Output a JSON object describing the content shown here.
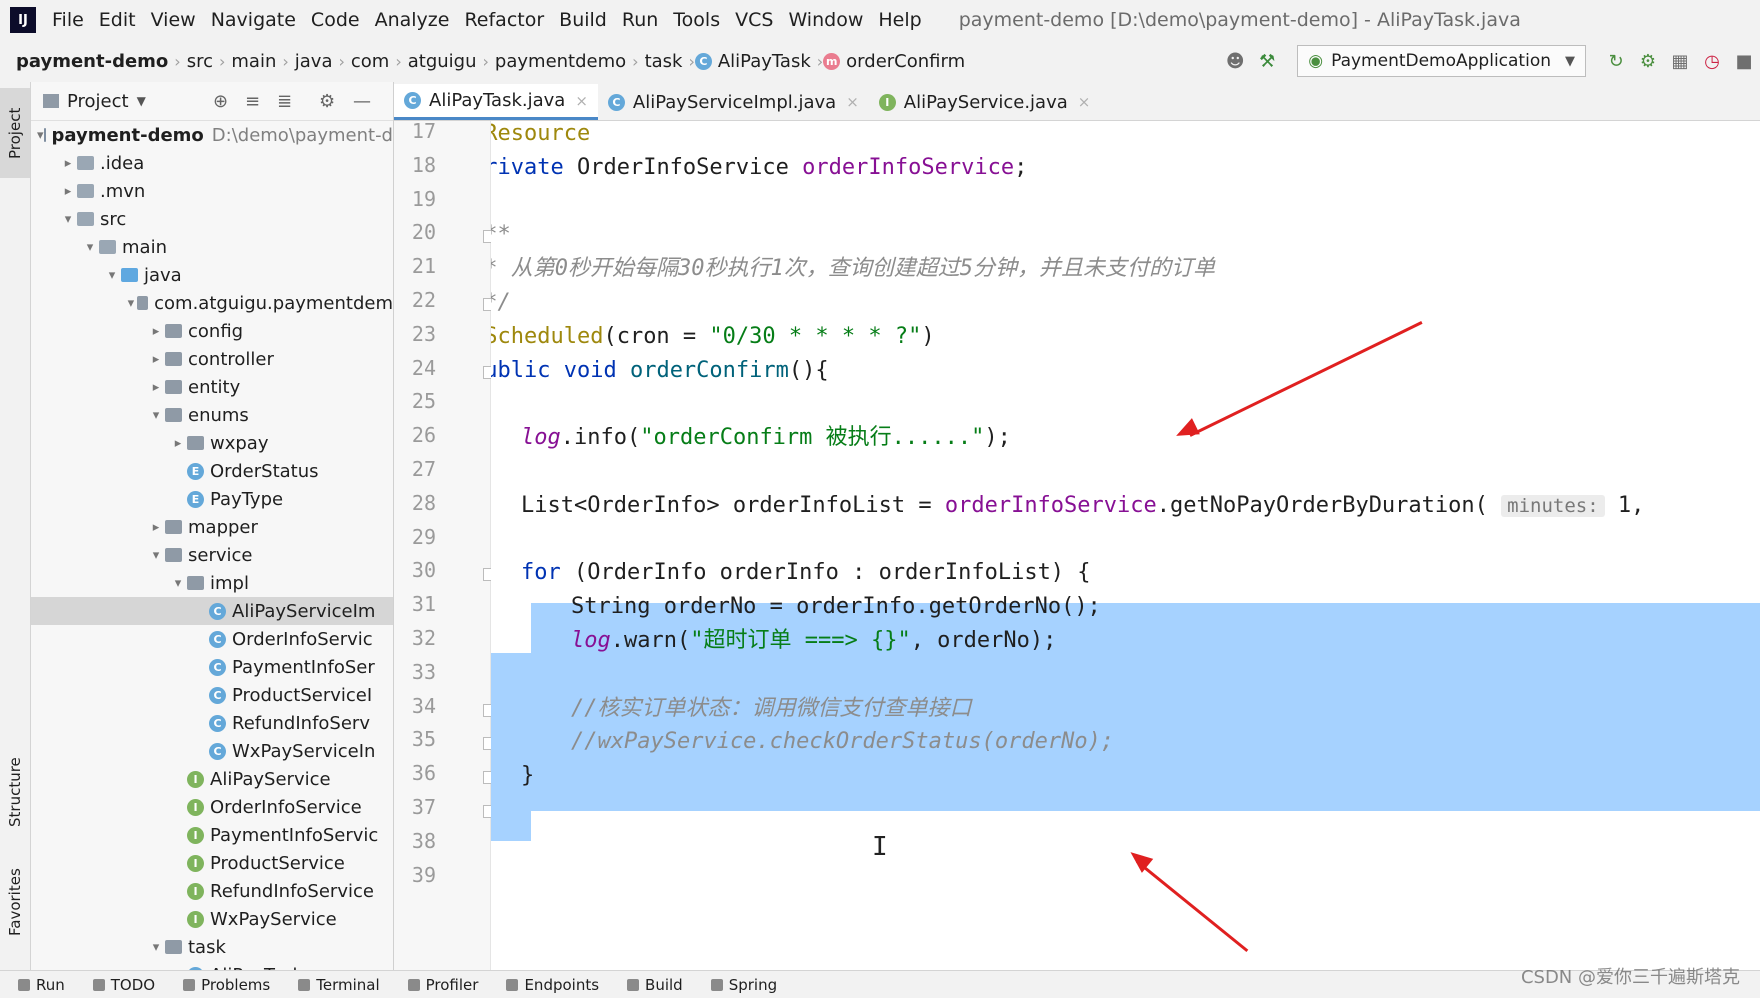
{
  "menubar": {
    "logo": "IJ",
    "items": [
      "File",
      "Edit",
      "View",
      "Navigate",
      "Code",
      "Analyze",
      "Refactor",
      "Build",
      "Run",
      "Tools",
      "VCS",
      "Window",
      "Help"
    ],
    "window_title": "payment-demo [D:\\demo\\payment-demo] - AliPayTask.java"
  },
  "breadcrumb": {
    "items": [
      "payment-demo",
      "src",
      "main",
      "java",
      "com",
      "atguigu",
      "paymentdemo",
      "task",
      "AliPayTask",
      "orderConfirm"
    ]
  },
  "run_config": {
    "label": "PaymentDemoApplication"
  },
  "side_tabs": {
    "project": "Project",
    "structure": "Structure",
    "favorites": "Favorites"
  },
  "project_panel": {
    "title": "Project",
    "tree": [
      {
        "label": "payment-demo",
        "path": "D:\\demo\\payment-d",
        "depth": 0,
        "arrow": "▾",
        "icon": "module",
        "bold": true
      },
      {
        "label": ".idea",
        "depth": 1,
        "arrow": "▸",
        "icon": "folder"
      },
      {
        "label": ".mvn",
        "depth": 1,
        "arrow": "▸",
        "icon": "folder"
      },
      {
        "label": "src",
        "depth": 1,
        "arrow": "▾",
        "icon": "folder"
      },
      {
        "label": "main",
        "depth": 2,
        "arrow": "▾",
        "icon": "folder"
      },
      {
        "label": "java",
        "depth": 3,
        "arrow": "▾",
        "icon": "blue"
      },
      {
        "label": "com.atguigu.paymentdem",
        "depth": 4,
        "arrow": "▾",
        "icon": "pkg"
      },
      {
        "label": "config",
        "depth": 5,
        "arrow": "▸",
        "icon": "pkg"
      },
      {
        "label": "controller",
        "depth": 5,
        "arrow": "▸",
        "icon": "pkg"
      },
      {
        "label": "entity",
        "depth": 5,
        "arrow": "▸",
        "icon": "pkg"
      },
      {
        "label": "enums",
        "depth": 5,
        "arrow": "▾",
        "icon": "pkg"
      },
      {
        "label": "wxpay",
        "depth": 6,
        "arrow": "▸",
        "icon": "pkg"
      },
      {
        "label": "OrderStatus",
        "depth": 6,
        "arrow": "",
        "icon": "E"
      },
      {
        "label": "PayType",
        "depth": 6,
        "arrow": "",
        "icon": "E"
      },
      {
        "label": "mapper",
        "depth": 5,
        "arrow": "▸",
        "icon": "pkg"
      },
      {
        "label": "service",
        "depth": 5,
        "arrow": "▾",
        "icon": "pkg"
      },
      {
        "label": "impl",
        "depth": 6,
        "arrow": "▾",
        "icon": "pkg"
      },
      {
        "label": "AliPayServiceIm",
        "depth": 7,
        "arrow": "",
        "icon": "C",
        "selected": true
      },
      {
        "label": "OrderInfoServic",
        "depth": 7,
        "arrow": "",
        "icon": "C"
      },
      {
        "label": "PaymentInfoSer",
        "depth": 7,
        "arrow": "",
        "icon": "C"
      },
      {
        "label": "ProductServiceI",
        "depth": 7,
        "arrow": "",
        "icon": "C"
      },
      {
        "label": "RefundInfoServ",
        "depth": 7,
        "arrow": "",
        "icon": "C"
      },
      {
        "label": "WxPayServiceIn",
        "depth": 7,
        "arrow": "",
        "icon": "C"
      },
      {
        "label": "AliPayService",
        "depth": 6,
        "arrow": "",
        "icon": "I"
      },
      {
        "label": "OrderInfoService",
        "depth": 6,
        "arrow": "",
        "icon": "I"
      },
      {
        "label": "PaymentInfoServic",
        "depth": 6,
        "arrow": "",
        "icon": "I"
      },
      {
        "label": "ProductService",
        "depth": 6,
        "arrow": "",
        "icon": "I"
      },
      {
        "label": "RefundInfoService",
        "depth": 6,
        "arrow": "",
        "icon": "I"
      },
      {
        "label": "WxPayService",
        "depth": 6,
        "arrow": "",
        "icon": "I"
      },
      {
        "label": "task",
        "depth": 5,
        "arrow": "▾",
        "icon": "pkg"
      },
      {
        "label": "AliPayTask",
        "depth": 6,
        "arrow": "",
        "icon": "C"
      }
    ]
  },
  "editor_tabs": [
    {
      "label": "AliPayTask.java",
      "active": true
    },
    {
      "label": "AliPayServiceImpl.java",
      "active": false
    },
    {
      "label": "AliPayService.java",
      "active": false,
      "icon": "I"
    }
  ],
  "code": {
    "lines": [
      {
        "n": "17",
        "parts": [
          [
            "ann",
            "@Resource"
          ]
        ],
        "indent": 0
      },
      {
        "n": "18",
        "parts": [
          [
            "kw",
            "private "
          ],
          [
            "",
            "OrderInfoService "
          ],
          [
            "fld",
            "orderInfoService"
          ],
          [
            "",
            ";"
          ]
        ],
        "indent": 0
      },
      {
        "n": "19",
        "parts": [],
        "indent": 0
      },
      {
        "n": "20",
        "parts": [
          [
            "doc",
            "/**"
          ]
        ],
        "indent": 0
      },
      {
        "n": "21",
        "parts": [
          [
            "doc",
            " * 从第0秒开始每隔30秒执行1次，查询创建超过5分钟，并且未支付的订单"
          ]
        ],
        "indent": 0
      },
      {
        "n": "22",
        "parts": [
          [
            "doc",
            " */"
          ]
        ],
        "indent": 0
      },
      {
        "n": "23",
        "parts": [
          [
            "ann",
            "@Scheduled"
          ],
          [
            "",
            "(cron = "
          ],
          [
            "str",
            "\"0/30 * * * * ?\""
          ],
          [
            "",
            ")"
          ]
        ],
        "indent": 0
      },
      {
        "n": "24",
        "parts": [
          [
            "kw",
            "public void "
          ],
          [
            "meth",
            "orderConfirm"
          ],
          [
            "",
            "(){"
          ]
        ],
        "indent": 0
      },
      {
        "n": "25",
        "parts": [],
        "indent": 0
      },
      {
        "n": "26",
        "parts": [
          [
            "slog",
            "log"
          ],
          [
            "",
            ".info("
          ],
          [
            "str",
            "\"orderConfirm 被执行......\""
          ],
          [
            "",
            ");"
          ]
        ],
        "indent": 1
      },
      {
        "n": "27",
        "parts": [],
        "indent": 0
      },
      {
        "n": "28",
        "parts": [
          [
            "",
            "List<OrderInfo> orderInfoList = "
          ],
          [
            "fld",
            "orderInfoService"
          ],
          [
            "",
            ".getNoPayOrderByDuration( "
          ],
          [
            "hint",
            "minutes:"
          ],
          [
            "",
            " 1,"
          ]
        ],
        "indent": 1
      },
      {
        "n": "29",
        "parts": [],
        "indent": 0
      },
      {
        "n": "30",
        "parts": [
          [
            "kw",
            "for "
          ],
          [
            "",
            "(OrderInfo orderInfo : orderInfoList) {"
          ]
        ],
        "indent": 1
      },
      {
        "n": "31",
        "parts": [
          [
            "",
            "String orderNo = orderInfo.getOrderNo();"
          ]
        ],
        "indent": 2
      },
      {
        "n": "32",
        "parts": [
          [
            "slog",
            "log"
          ],
          [
            "",
            ".warn("
          ],
          [
            "str",
            "\"超时订单 ===> {}\""
          ],
          [
            "",
            ", orderNo);"
          ]
        ],
        "indent": 2
      },
      {
        "n": "33",
        "parts": [],
        "indent": 0
      },
      {
        "n": "34",
        "parts": [
          [
            "cmt",
            "//核实订单状态：调用微信支付查单接口"
          ]
        ],
        "indent": 2
      },
      {
        "n": "35",
        "parts": [
          [
            "cmt",
            "//wxPayService.checkOrderStatus(orderNo);"
          ]
        ],
        "indent": 2
      },
      {
        "n": "36",
        "parts": [
          [
            "",
            "}"
          ]
        ],
        "indent": 1
      },
      {
        "n": "37",
        "parts": [
          [
            "",
            "}"
          ]
        ],
        "indent": 0
      },
      {
        "n": "38",
        "parts": [],
        "indent": 0
      },
      {
        "n": "39",
        "parts": [],
        "indent": 0
      }
    ]
  },
  "bottom_tabs": [
    "Run",
    "TODO",
    "Problems",
    "Terminal",
    "Profiler",
    "Endpoints",
    "Build",
    "Spring"
  ],
  "watermark": "CSDN @爱你三千遍斯塔克",
  "colors": {
    "selection": "#a6d2ff",
    "annotation_arrow": "#e02020",
    "keyword": "#0033b3"
  }
}
